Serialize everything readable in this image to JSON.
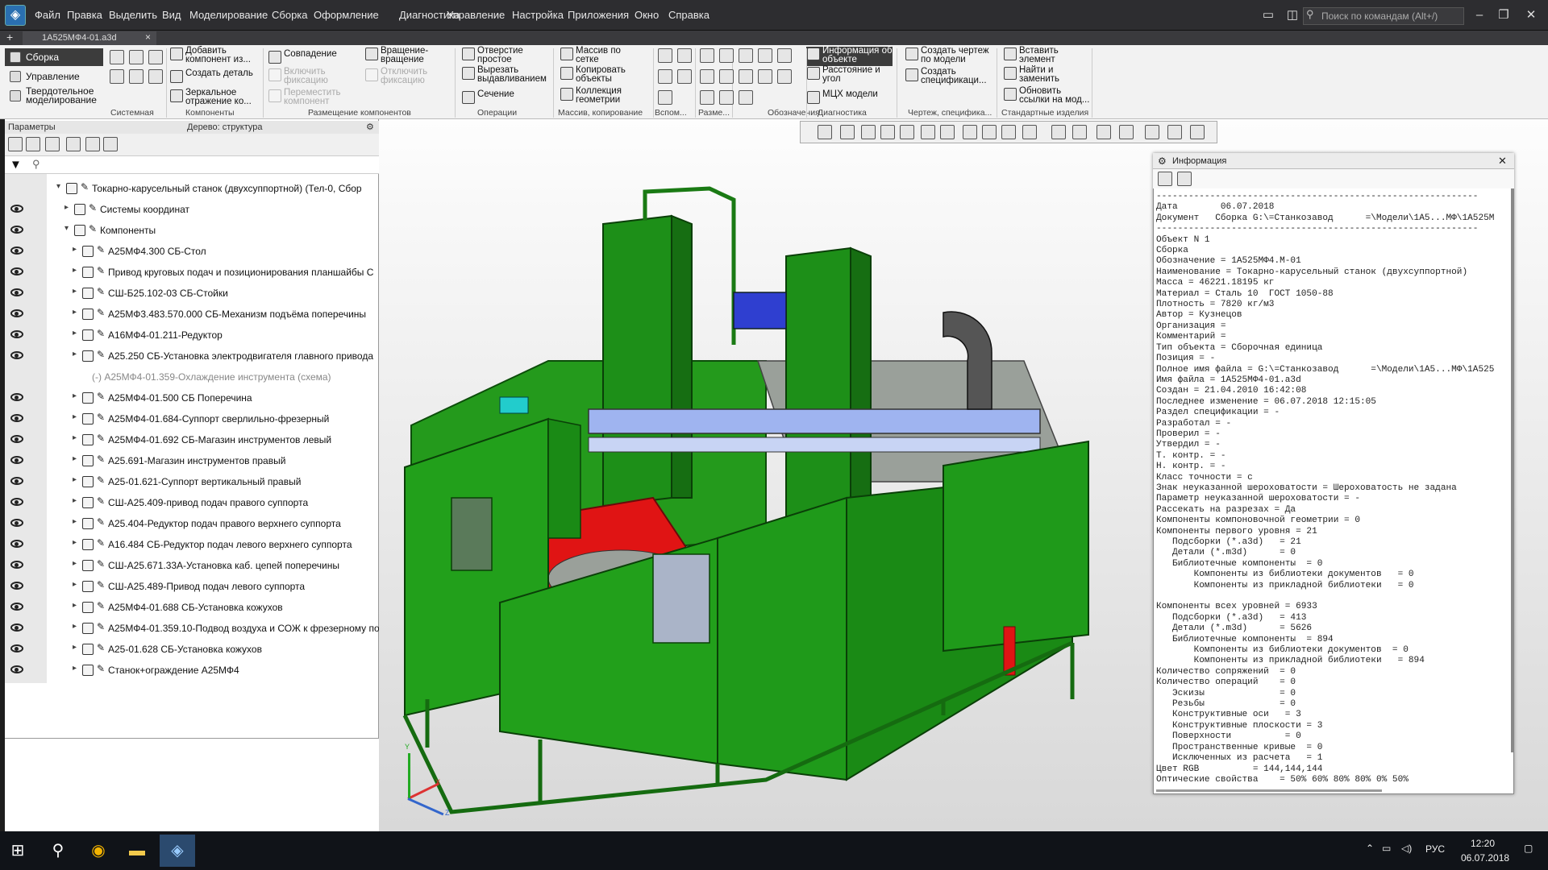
{
  "menu": {
    "items": [
      "Файл",
      "Правка",
      "Выделить",
      "Вид",
      "Моделирование",
      "Сборка",
      "Оформление",
      "Диагностика",
      "Управление",
      "Настройка",
      "Приложения",
      "Окно",
      "Справка"
    ],
    "search_placeholder": "Поиск по командам (Alt+/)"
  },
  "tab": {
    "title": "1А525МФ4-01.a3d",
    "close": "×",
    "add": "+"
  },
  "ribbon": {
    "side": [
      "Сборка",
      "Управление",
      "Твердотельное\nмоделирование"
    ],
    "buttons": [
      {
        "label": "Добавить\nкомпонент из..."
      },
      {
        "label": "Создать деталь"
      },
      {
        "label": "Зеркальное\nотражение ко..."
      },
      {
        "label": "Совпадение"
      },
      {
        "label": "Включить\nфиксацию",
        "disabled": true
      },
      {
        "label": "Переместить\nкомпонент",
        "disabled": true
      },
      {
        "label": "Вращение-\nвращение"
      },
      {
        "label": "Отключить\nфиксацию",
        "disabled": true
      },
      {
        "label": "Отверстие\nпростое"
      },
      {
        "label": "Вырезать\nвыдавливанием"
      },
      {
        "label": "Сечение"
      },
      {
        "label": "Массив по\nсетке"
      },
      {
        "label": "Копировать\nобъекты"
      },
      {
        "label": "Коллекция\nгеометрии"
      },
      {
        "label": "Информация об\nобъекте",
        "active": true
      },
      {
        "label": "Расстояние и\nугол"
      },
      {
        "label": "МЦХ модели"
      },
      {
        "label": "Создать чертеж\nпо модели"
      },
      {
        "label": "Создать\nспецификаци..."
      },
      {
        "label": "Вставить\nэлемент"
      },
      {
        "label": "Найти и\nзаменить"
      },
      {
        "label": "Обновить\nссылки на мод..."
      }
    ],
    "groups": [
      "Системная",
      "Компоненты",
      "Размещение компонентов",
      "Операции",
      "Массив, копирование",
      "Вспом...",
      "Разме...",
      "Обозначения",
      "Диагностика",
      "Чертеж, специфика...",
      "Стандартные изделия"
    ]
  },
  "panel": {
    "params_label": "Параметры",
    "tree_label": "Дерево: структура"
  },
  "tree": [
    {
      "label": "Токарно-карусельный станок (двухсуппортной) (Тел-0, Сбор",
      "level": 0,
      "eye": false,
      "expanded": true
    },
    {
      "label": "Системы координат",
      "level": 1,
      "eye": true,
      "expanded": false
    },
    {
      "label": "Компоненты",
      "level": 1,
      "eye": true,
      "expanded": true
    },
    {
      "label": "А25МФ4.300 СБ-Стол",
      "level": 2,
      "eye": true
    },
    {
      "label": "Привод круговых подач и позиционирования планшайбы С",
      "level": 2,
      "eye": true
    },
    {
      "label": "СШ-Б25.102-03 СБ-Стойки",
      "level": 2,
      "eye": true
    },
    {
      "label": "А25МФ3.483.570.000 СБ-Механизм подъёма поперечины",
      "level": 2,
      "eye": true
    },
    {
      "label": "А16МФ4-01.211-Редуктор",
      "level": 2,
      "eye": true
    },
    {
      "label": "А25.250 СБ-Установка электродвигателя главного привода",
      "level": 2,
      "eye": true
    },
    {
      "label": "(-) А25МФ4-01.359-Охлаждение инструмента (схема)",
      "level": 2,
      "eye": false,
      "gray": true
    },
    {
      "label": "А25МФ4-01.500 СБ Поперечина",
      "level": 2,
      "eye": true
    },
    {
      "label": "А25МФ4-01.684-Суппорт сверлильно-фрезерный",
      "level": 2,
      "eye": true
    },
    {
      "label": "А25МФ4-01.692 СБ-Магазин инструментов левый",
      "level": 2,
      "eye": true
    },
    {
      "label": "А25.691-Магазин инструментов правый",
      "level": 2,
      "eye": true
    },
    {
      "label": "А25-01.621-Суппорт вертикальный правый",
      "level": 2,
      "eye": true
    },
    {
      "label": "СШ-А25.409-привод подач правого суппорта",
      "level": 2,
      "eye": true
    },
    {
      "label": "А25.404-Редуктор подач правого верхнего суппорта",
      "level": 2,
      "eye": true
    },
    {
      "label": "А16.484 СБ-Редуктор подач левого верхнего суппорта",
      "level": 2,
      "eye": true
    },
    {
      "label": "СШ-А25.671.33А-Установка каб. цепей поперечины",
      "level": 2,
      "eye": true
    },
    {
      "label": "СШ-А25.489-Привод подач левого суппорта",
      "level": 2,
      "eye": true
    },
    {
      "label": "А25МФ4-01.688 СБ-Установка кожухов",
      "level": 2,
      "eye": true
    },
    {
      "label": "А25МФ4-01.359.10-Подвод воздуха и СОЖ к фрезерному по",
      "level": 2,
      "eye": true
    },
    {
      "label": "А25-01.628 СБ-Установка кожухов",
      "level": 2,
      "eye": true
    },
    {
      "label": "Станок+ограждение А25МФ4",
      "level": 2,
      "eye": true
    }
  ],
  "info": {
    "title": "Информация",
    "lines": [
      "------------------------------------------------------------",
      "Дата        06.07.2018",
      "Документ   Сборка G:\\=Станкозавод      =\\Модели\\1А5...МФ\\1А525М",
      "------------------------------------------------------------",
      "Объект N 1",
      "Сборка",
      "Обозначение = 1А525МФ4.М-01",
      "Наименование = Токарно-карусельный станок (двухсуппортной)",
      "Масса = 46221.18195 кг",
      "Материал = Сталь 10  ГОСТ 1050-88",
      "Плотность = 7820 кг/м3",
      "Автор = Кузнецов",
      "Организация =",
      "Комментарий =",
      "Тип объекта = Сборочная единица",
      "Позиция = -",
      "Полное имя файла = G:\\=Станкозавод      =\\Модели\\1А5...МФ\\1А525",
      "Имя файла = 1А525МФ4-01.a3d",
      "Создан = 21.04.2010 16:42:08",
      "Последнее изменение = 06.07.2018 12:15:05",
      "Раздел спецификации = -",
      "Разработал = -",
      "Проверил = -",
      "Утвердил = -",
      "Т. контр. = -",
      "Н. контр. = -",
      "Класс точности = с",
      "Знак неуказанной шероховатости = Шероховатость не задана",
      "Параметр неуказанной шероховатости = -",
      "Рассекать на разрезах = Да",
      "Компоненты компоновочной геометрии = 0",
      "Компоненты первого уровня = 21",
      "   Подсборки (*.a3d)   = 21",
      "   Детали (*.m3d)      = 0",
      "   Библиотечные компоненты  = 0",
      "       Компоненты из библиотеки документов   = 0",
      "       Компоненты из прикладной библиотеки   = 0",
      "",
      "Компоненты всех уровней = 6933",
      "   Подсборки (*.a3d)   = 413",
      "   Детали (*.m3d)      = 5626",
      "   Библиотечные компоненты  = 894",
      "       Компоненты из библиотеки документов  = 0",
      "       Компоненты из прикладной библиотеки   = 894",
      "Количество сопряжений  = 0",
      "Количество операций    = 0",
      "   Эскизы              = 0",
      "   Резьбы              = 0",
      "   Конструктивные оси   = 3",
      "   Конструктивные плоскости = 3",
      "   Поверхности          = 0",
      "   Пространственные кривые  = 0",
      "   Исключенных из расчета   = 1",
      "Цвет RGB          = 144,144,144",
      "Оптические свойства    = 50% 60% 80% 80% 0% 50%"
    ]
  },
  "axes": {
    "x": "X",
    "y": "Y",
    "z": "Z"
  },
  "tray": {
    "lang": "РУС",
    "time": "12:20",
    "date": "06.07.2018"
  },
  "colors": {
    "model_green": "#1f9a1a",
    "model_red": "#e41212",
    "model_blue": "#8aa6ee",
    "accent_dark": "#3c3c3c"
  }
}
